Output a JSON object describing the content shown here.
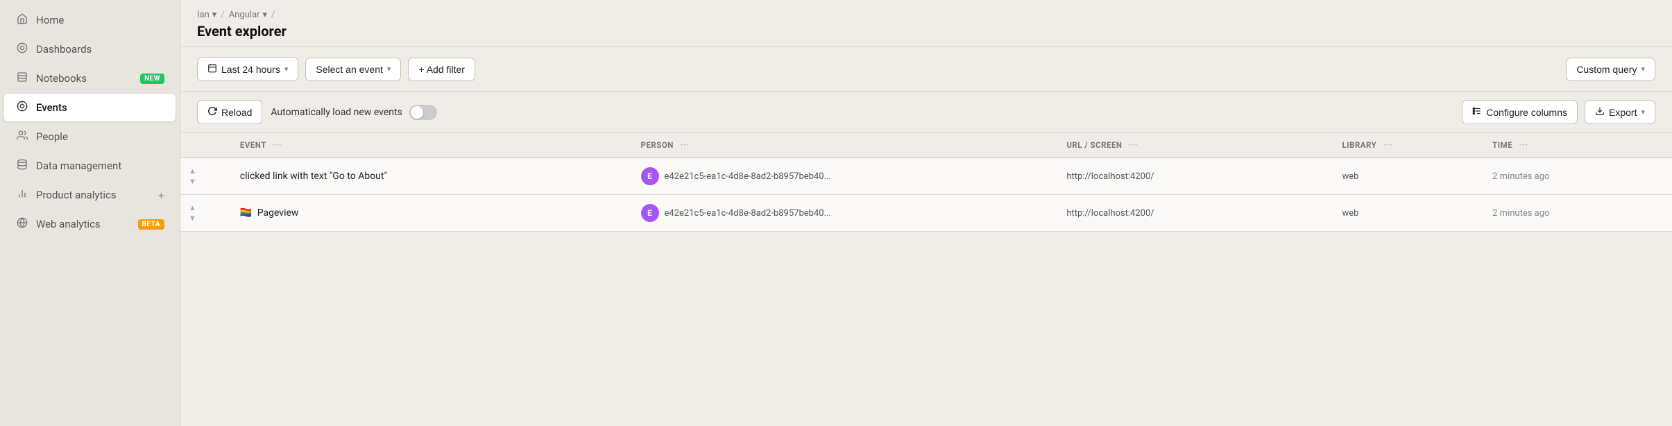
{
  "sidebar": {
    "items": [
      {
        "id": "home",
        "label": "Home",
        "icon": "⌂",
        "active": false
      },
      {
        "id": "dashboards",
        "label": "Dashboards",
        "icon": "○",
        "active": false
      },
      {
        "id": "notebooks",
        "label": "Notebooks",
        "icon": "☰",
        "active": false,
        "badge": "NEW",
        "badge_type": "new"
      },
      {
        "id": "events",
        "label": "Events",
        "icon": "◎",
        "active": true
      },
      {
        "id": "people",
        "label": "People",
        "icon": "👤",
        "active": false
      },
      {
        "id": "data-management",
        "label": "Data management",
        "icon": "🗄",
        "active": false
      },
      {
        "id": "product-analytics",
        "label": "Product analytics",
        "icon": "📊",
        "active": false,
        "has_plus": true
      },
      {
        "id": "web-analytics",
        "label": "Web analytics",
        "icon": "🌐",
        "active": false,
        "badge": "BETA",
        "badge_type": "beta"
      }
    ]
  },
  "header": {
    "breadcrumb": {
      "workspace": "Ian",
      "project": "Angular",
      "separator": "/"
    },
    "title": "Event explorer"
  },
  "toolbar": {
    "time_filter": "Last 24 hours",
    "event_filter": "Select an event",
    "add_filter": "+ Add filter",
    "custom_query": "Custom query"
  },
  "toolbar2": {
    "reload_label": "Reload",
    "auto_load_label": "Automatically load new events",
    "configure_columns_label": "Configure columns",
    "export_label": "Export"
  },
  "table": {
    "columns": [
      {
        "id": "event",
        "label": "EVENT"
      },
      {
        "id": "person",
        "label": "PERSON"
      },
      {
        "id": "url",
        "label": "URL / SCREEN"
      },
      {
        "id": "library",
        "label": "LIBRARY"
      },
      {
        "id": "time",
        "label": "TIME"
      }
    ],
    "rows": [
      {
        "event": "clicked link with text \"Go to About\"",
        "event_type": "click",
        "person_avatar": "E",
        "person_id": "e42e21c5-ea1c-4d8e-8ad2-b8957beb40...",
        "url": "http://localhost:4200/",
        "library": "web",
        "time": "2 minutes ago"
      },
      {
        "event": "Pageview",
        "event_type": "pageview",
        "person_avatar": "E",
        "person_id": "e42e21c5-ea1c-4d8e-8ad2-b8957beb40...",
        "url": "http://localhost:4200/",
        "library": "web",
        "time": "2 minutes ago"
      }
    ]
  }
}
